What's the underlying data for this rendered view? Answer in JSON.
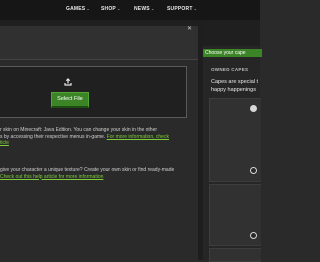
{
  "nav": {
    "games": "GAMES",
    "shop": "SHOP",
    "news": "NEWS",
    "support": "SUPPORT",
    "chevron": "⌄"
  },
  "upload": {
    "button_label": "Select File",
    "icon": "upload-icon"
  },
  "description_1": {
    "line1": "r skin on Minecraft: Java Edition. You can change your skin in the other",
    "line2_text": "s by accessing their respective menus in-game. ",
    "line2_link": "For more information, check",
    "line3_link": "ticle"
  },
  "description_2": {
    "line1": "give your character a unique texture? Create your own skin or find ready-made",
    "line2_link": "Check out this help article for more information"
  },
  "sidebar": {
    "choose_cape": "Choose your cape",
    "owned_capes": "OWNED CAPES",
    "capes_line1": "Capes are special t",
    "capes_line2": "happy happenings"
  },
  "colors": {
    "accent_green": "#3c8527",
    "link_green": "#7fcc3c",
    "background": "#2a2a2a",
    "nav_bg": "#161616"
  }
}
